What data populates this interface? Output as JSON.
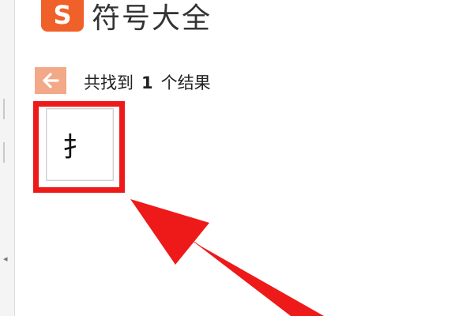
{
  "app": {
    "logo_text": "S",
    "title": "符号大全"
  },
  "results": {
    "prefix": "共找到",
    "count": "1",
    "suffix": "个结果"
  },
  "symbols": [
    "扌"
  ],
  "colors": {
    "brand_orange": "#f0612a",
    "back_button_bg": "#f3a887",
    "annotation_red": "#ee1a1a"
  },
  "icons": {
    "back": "left-arrow-icon",
    "annotation": "red-arrow-annotation"
  }
}
